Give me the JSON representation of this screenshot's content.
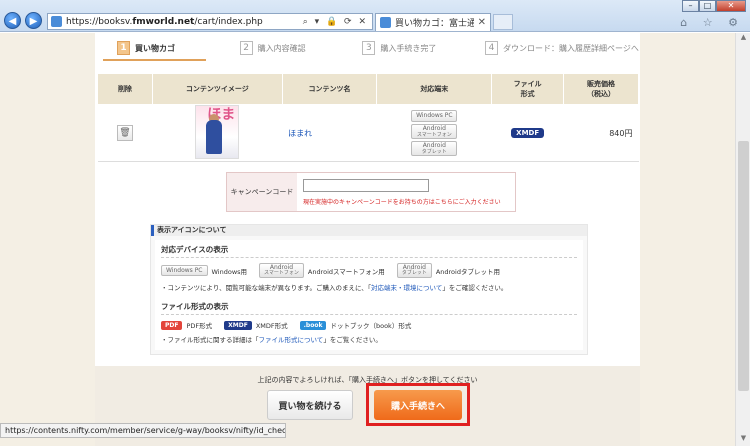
{
  "browser": {
    "url_prefix": "https://booksv.",
    "url_host": "fmworld.net",
    "url_path": "/cart/index.php",
    "addr_tools": "⌕ ▾ 🔒 ⟳ ✕",
    "tab_title": "買い物カゴ：富士通の電...",
    "back_icon": "arrow-left",
    "forward_icon": "arrow-right",
    "right_icons": "⌂ ☆ ⚙"
  },
  "steps": [
    {
      "num": "1",
      "label": "買い物カゴ"
    },
    {
      "num": "2",
      "label": "購入内容確認"
    },
    {
      "num": "3",
      "label": "購入手続き完了"
    },
    {
      "num": "4",
      "label": "ダウンロード：購入履歴詳細ページへ"
    }
  ],
  "cart": {
    "headers": {
      "delete": "削除",
      "image": "コンテンツイメージ",
      "name": "コンテンツ名",
      "devices": "対応端末",
      "format_line1": "ファイル",
      "format_line2": "形式",
      "price_line1": "販売価格",
      "price_line2": "（税込）"
    },
    "item": {
      "title": "ほまれ",
      "cover_kana": "ほま",
      "devices": {
        "windows": "Windows PC",
        "android_phone": "Android",
        "android_phone_sub": "スマートフォン",
        "android_tablet": "Android",
        "android_tablet_sub": "タブレット"
      },
      "format": "XMDF",
      "price": "840円"
    }
  },
  "campaign": {
    "label": "キャンペーンコード",
    "input_value": "",
    "note": "現在実施中のキャンペーンコードをお持ちの方はこちらにご入力ください"
  },
  "legend": {
    "header": "表示アイコンについて",
    "devices_title": "対応デバイスの表示",
    "win_pill": "Windows PC",
    "win_text": "Windows用",
    "and_pill": "Android",
    "and_pill_sub": "スマートフォン",
    "and_text": "Androidスマートフォン用",
    "tab_pill": "Android",
    "tab_pill_sub": "タブレット",
    "tab_text": "Androidタブレット用",
    "devices_note_pre": "・コンテンツにより、閲覧可能な端末が異なります。ご購入のまえに、「",
    "devices_note_link": "対応端末・環境について",
    "devices_note_post": "」をご確認ください。",
    "format_title": "ファイル形式の表示",
    "pdf_pill": "PDF",
    "pdf_text": "PDF形式",
    "xmdf_pill": "XMDF",
    "xmdf_text": "XMDF形式",
    "book_pill": ".book",
    "book_text": "ドットブック（book）形式",
    "format_note_pre": "・ファイル形式に関する詳細は「",
    "format_note_link": "ファイル形式について",
    "format_note_post": "」をご覧ください。"
  },
  "actions": {
    "message": "上記の内容でよろしければ、「購入手続きへ」ボタンを押してください",
    "continue_label": "買い物を続ける",
    "proceed_label": "購入手続きへ"
  },
  "status_bar": "https://contents.nifty.com/member/service/g-way/booksv/nifty/id_check.php",
  "colors": {
    "accent_orange": "#ef6a1a",
    "highlight_red": "#e02020",
    "link_blue": "#1a55b8"
  }
}
